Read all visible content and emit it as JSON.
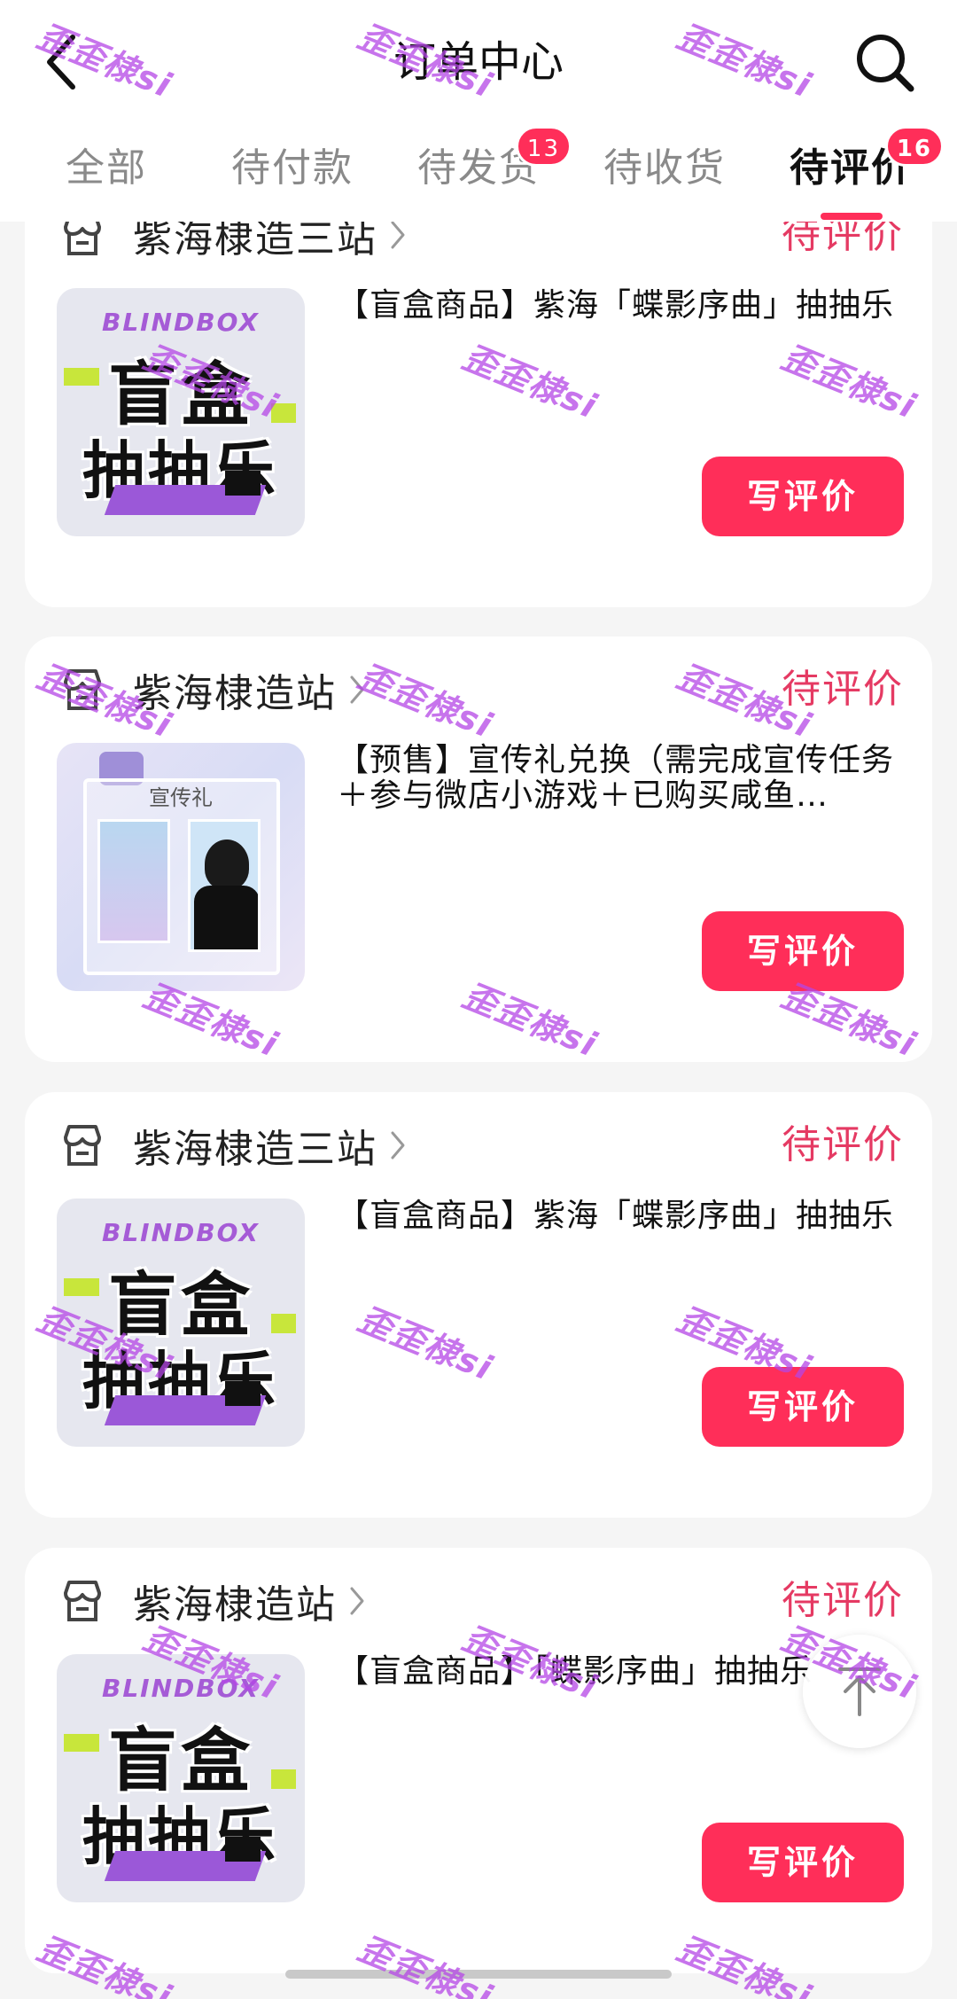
{
  "header": {
    "title": "订单中心"
  },
  "tabs": [
    {
      "label": "全部",
      "badge": null,
      "active": false
    },
    {
      "label": "待付款",
      "badge": null,
      "active": false
    },
    {
      "label": "待发货",
      "badge": "13",
      "active": false
    },
    {
      "label": "待收货",
      "badge": null,
      "active": false
    },
    {
      "label": "待评价",
      "badge": "16",
      "active": true
    }
  ],
  "orders": [
    {
      "shop": "紫海棣造三站",
      "status": "待评价",
      "title": "【盲盒商品】紫海「蝶影序曲」抽抽乐",
      "button": "写评价",
      "image": "blindbox"
    },
    {
      "shop": "紫海棣造站",
      "status": "待评价",
      "title": "【预售】宣传礼兑换（需完成宣传任务＋参与微店小游戏＋已购买咸鱼…",
      "button": "写评价",
      "image": "promo"
    },
    {
      "shop": "紫海棣造三站",
      "status": "待评价",
      "title": "【盲盒商品】紫海「蝶影序曲」抽抽乐",
      "button": "写评价",
      "image": "blindbox"
    },
    {
      "shop": "紫海棣造站",
      "status": "待评价",
      "title": "【盲盒商品】「蝶影序曲」抽抽乐",
      "button": "写评价",
      "image": "blindbox"
    }
  ],
  "blindbox_art": {
    "word": "BLINDBOX",
    "line1": "盲盒",
    "line2": "抽抽乐"
  },
  "promo_art": {
    "gift_text": "宣传礼"
  },
  "watermark_text": "歪歪棣si",
  "colors": {
    "accent": "#ff2e59",
    "status": "#e53a63",
    "watermark": "#b446e6",
    "background": "#f5f5f5"
  },
  "icons": {
    "back": "chevron-left-icon",
    "search": "search-icon",
    "shop": "store-icon",
    "chevron": "chevron-right-icon",
    "back_to_top": "arrow-up-icon"
  }
}
